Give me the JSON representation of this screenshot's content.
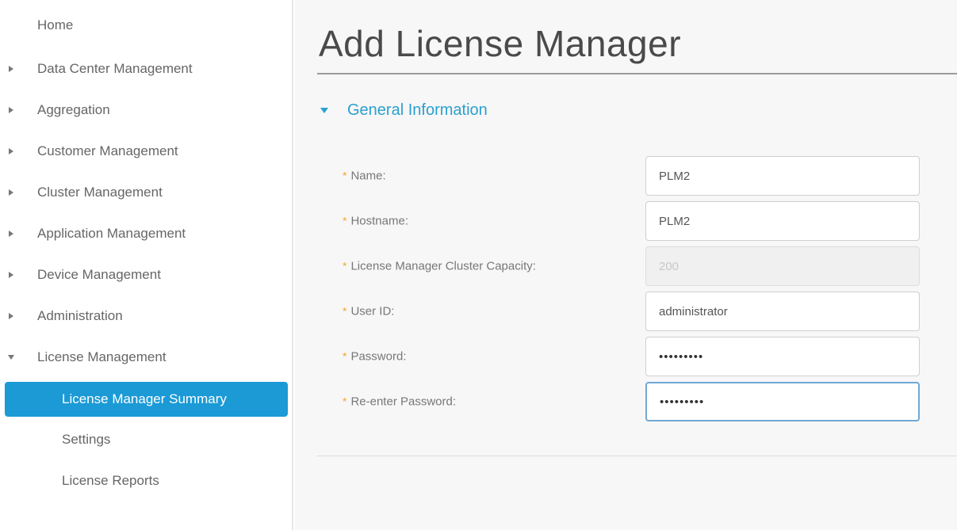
{
  "sidebar": {
    "items": [
      {
        "label": "Home"
      },
      {
        "label": "Data Center Management"
      },
      {
        "label": "Aggregation"
      },
      {
        "label": "Customer Management"
      },
      {
        "label": "Cluster Management"
      },
      {
        "label": "Application Management"
      },
      {
        "label": "Device Management"
      },
      {
        "label": "Administration"
      },
      {
        "label": "License Management"
      }
    ],
    "subitems": [
      {
        "label": "License Manager Summary"
      },
      {
        "label": "Settings"
      },
      {
        "label": "License Reports"
      }
    ]
  },
  "main": {
    "title": "Add License Manager",
    "section": "General Information",
    "required_marker": "*",
    "fields": [
      {
        "label": "Name:",
        "value": "PLM2"
      },
      {
        "label": "Hostname:",
        "value": "PLM2"
      },
      {
        "label": "License Manager Cluster Capacity:",
        "value": "200"
      },
      {
        "label": "User ID:",
        "value": "administrator"
      },
      {
        "label": "Password:",
        "value": "•••••••••"
      },
      {
        "label": "Re-enter Password:",
        "value": "•••••••••"
      }
    ]
  },
  "colors": {
    "accent": "#1b9ad6",
    "section_link": "#2aa0cf",
    "required": "#f0a830"
  }
}
